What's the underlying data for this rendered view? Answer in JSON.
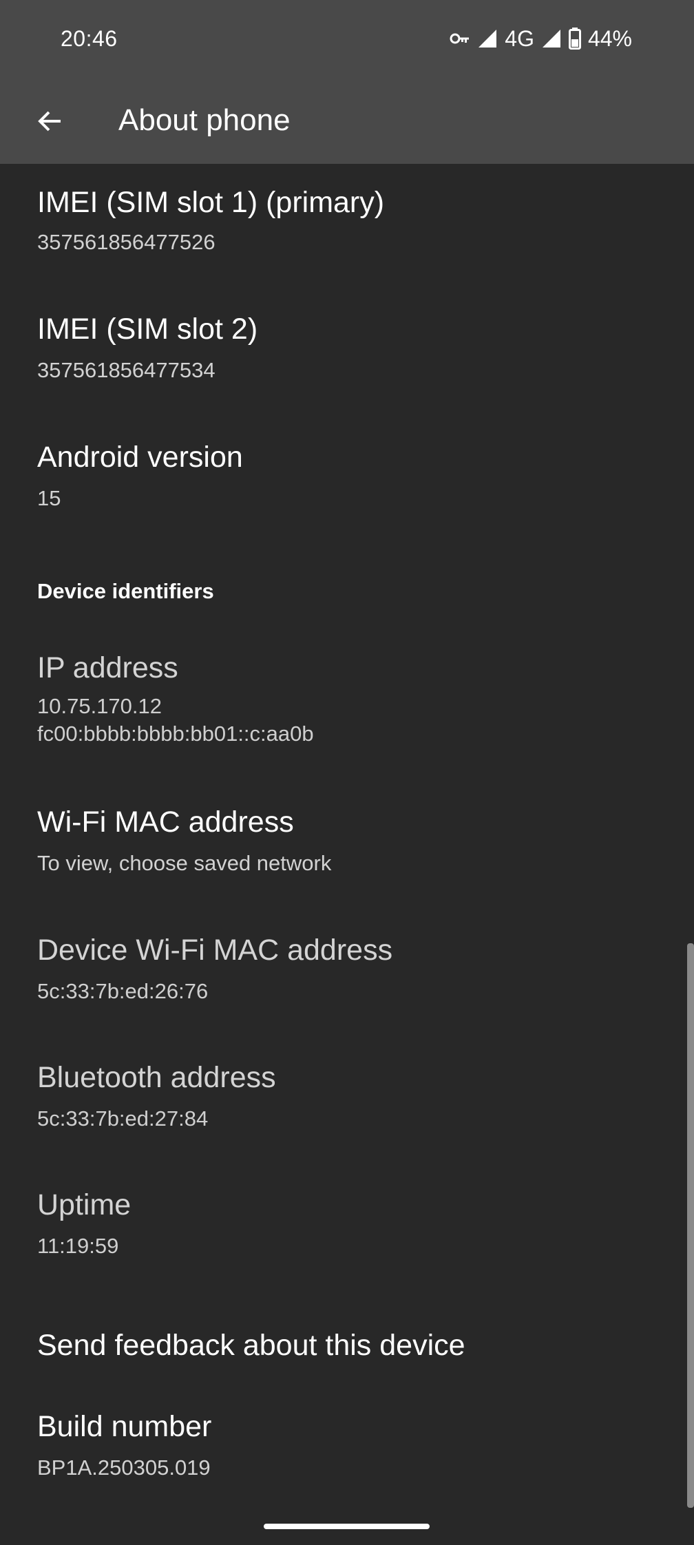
{
  "status_bar": {
    "time": "20:46",
    "network_type": "4G",
    "battery": "44%",
    "icons": [
      "vpn-key-icon",
      "signal-icon",
      "signal-icon",
      "battery-icon"
    ]
  },
  "app_bar": {
    "title": "About phone",
    "back_icon": "arrow-back-icon"
  },
  "items": [
    {
      "title": "IMEI (SIM slot 1) (primary)",
      "summary": "357561856477526"
    },
    {
      "title": "IMEI (SIM slot 2)",
      "summary": "357561856477534"
    },
    {
      "title": "Android version",
      "summary": "15"
    }
  ],
  "section": {
    "header": "Device identifiers",
    "items": [
      {
        "title": "IP address",
        "summary_line1": "10.75.170.12",
        "summary_line2": "fc00:bbbb:bbbb:bb01::c:aa0b"
      },
      {
        "title": "Wi-Fi MAC address",
        "summary": "To view, choose saved network"
      },
      {
        "title": "Device Wi-Fi MAC address",
        "summary": "5c:33:7b:ed:26:76"
      },
      {
        "title": "Bluetooth address",
        "summary": "5c:33:7b:ed:27:84"
      },
      {
        "title": "Uptime",
        "summary": "11:19:59"
      },
      {
        "title": "Send feedback about this device"
      },
      {
        "title": "Build number",
        "summary": "BP1A.250305.019"
      }
    ]
  },
  "colors": {
    "background": "#282828",
    "app_bar": "#494949",
    "text_primary": "#ffffff",
    "text_secondary": "#d2d2d2"
  }
}
